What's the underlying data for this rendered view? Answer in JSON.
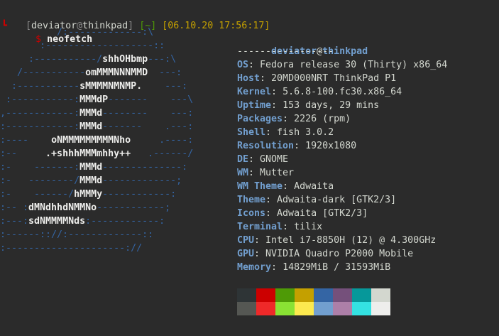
{
  "prompt": {
    "bracket_open": "[",
    "user": "deviator",
    "at": "@",
    "host": "thinkpad",
    "bracket_close": "]",
    "cwd": "[~]",
    "timestamp": "[06.10.20 17:56:17]",
    "dollar": "$",
    "command": "neofetch",
    "corner_glyph": "┗"
  },
  "logo_lines": [
    "          /:-------------:\\",
    "       :-------------------::",
    "     :-----------/shhOHbmp---:\\",
    "   /-----------omMMMNNNMMD  ---:",
    "  :-----------sMMMMNMNMP.    ---:",
    " :-----------:MMMdP-------    ---\\",
    ",------------:MMMd--------    ---:",
    ":------------:MMMd-------    .---:",
    ":----    oNMMMMMMMMMNho     .----:",
    ":--     .+shhhMMMmhhy++   .------/",
    ":-    -------:MMMd--------------:",
    ":-   --------/MMMd-------------;",
    ":-    ------/hMMMy------------:",
    ":-- :dMNdhhdNMMNo------------;",
    ":---:sdNMMMMNds:------------:",
    ":------:://:-------------::",
    ":---------------------://"
  ],
  "info": {
    "title_user": "deviator",
    "title_at": "@",
    "title_host": "thinkpad",
    "separator": "-----------------",
    "rows": [
      {
        "key": "OS",
        "value": "Fedora release 30 (Thirty) x86_64"
      },
      {
        "key": "Host",
        "value": "20MD000NRT ThinkPad P1"
      },
      {
        "key": "Kernel",
        "value": "5.6.8-100.fc30.x86_64"
      },
      {
        "key": "Uptime",
        "value": "153 days, 29 mins"
      },
      {
        "key": "Packages",
        "value": "2226 (rpm)"
      },
      {
        "key": "Shell",
        "value": "fish 3.0.2"
      },
      {
        "key": "Resolution",
        "value": "1920x1080"
      },
      {
        "key": "DE",
        "value": "GNOME"
      },
      {
        "key": "WM",
        "value": "Mutter"
      },
      {
        "key": "WM Theme",
        "value": "Adwaita"
      },
      {
        "key": "Theme",
        "value": "Adwaita-dark [GTK2/3]"
      },
      {
        "key": "Icons",
        "value": "Adwaita [GTK2/3]"
      },
      {
        "key": "Terminal",
        "value": "tilix"
      },
      {
        "key": "CPU",
        "value": "Intel i7-8850H (12) @ 4.300GHz"
      },
      {
        "key": "GPU",
        "value": "NVIDIA Quadro P2000 Mobile"
      },
      {
        "key": "Memory",
        "value": "14829MiB / 31593MiB"
      }
    ],
    "key_suffix": ": "
  },
  "palette": {
    "top": [
      "#2e3436",
      "#cc0000",
      "#4e9a06",
      "#c4a000",
      "#3465a4",
      "#75507b",
      "#06989a",
      "#d3d7cf"
    ],
    "bottom": [
      "#555753",
      "#ef2929",
      "#8ae234",
      "#fce94f",
      "#729fcf",
      "#ad7fa8",
      "#34e2e2",
      "#eeeeec"
    ]
  }
}
